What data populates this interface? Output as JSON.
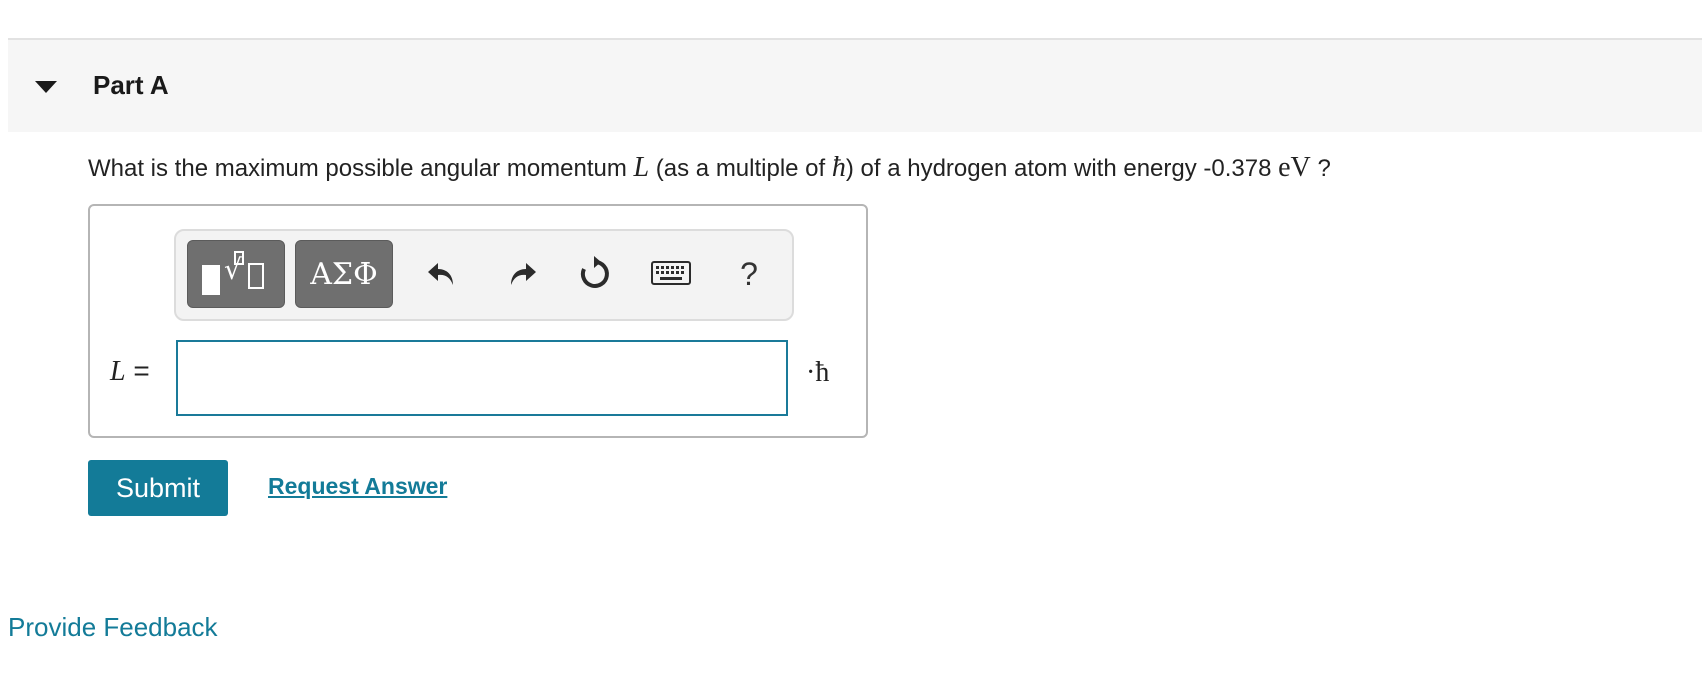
{
  "part": {
    "title": "Part A",
    "toggle_icon": "caret-down-icon"
  },
  "question": {
    "text_before": "What is the maximum possible angular momentum ",
    "symbol_L": "L",
    "text_mid1": " (as a multiple of ",
    "symbol_hbar": "ħ",
    "text_mid2": ") of a hydrogen atom with energy -0.378 ",
    "unit_eV": "eV",
    "text_after": " ?"
  },
  "toolbar": {
    "templates_icon": "templates-icon",
    "greek_label": "ΑΣΦ",
    "undo_icon": "undo-icon",
    "redo_icon": "redo-icon",
    "reset_icon": "reset-icon",
    "keyboard_icon": "keyboard-icon",
    "help_label": "?"
  },
  "answer": {
    "variable_label": "L",
    "equals": " =",
    "value": "",
    "placeholder": "",
    "unit": "·ħ"
  },
  "actions": {
    "submit_label": "Submit",
    "request_answer_label": "Request Answer"
  },
  "footer": {
    "feedback_label": "Provide Feedback"
  },
  "colors": {
    "accent": "#137b98",
    "toolbar_button": "#6f6f6f",
    "header_bg": "#f6f6f6"
  }
}
